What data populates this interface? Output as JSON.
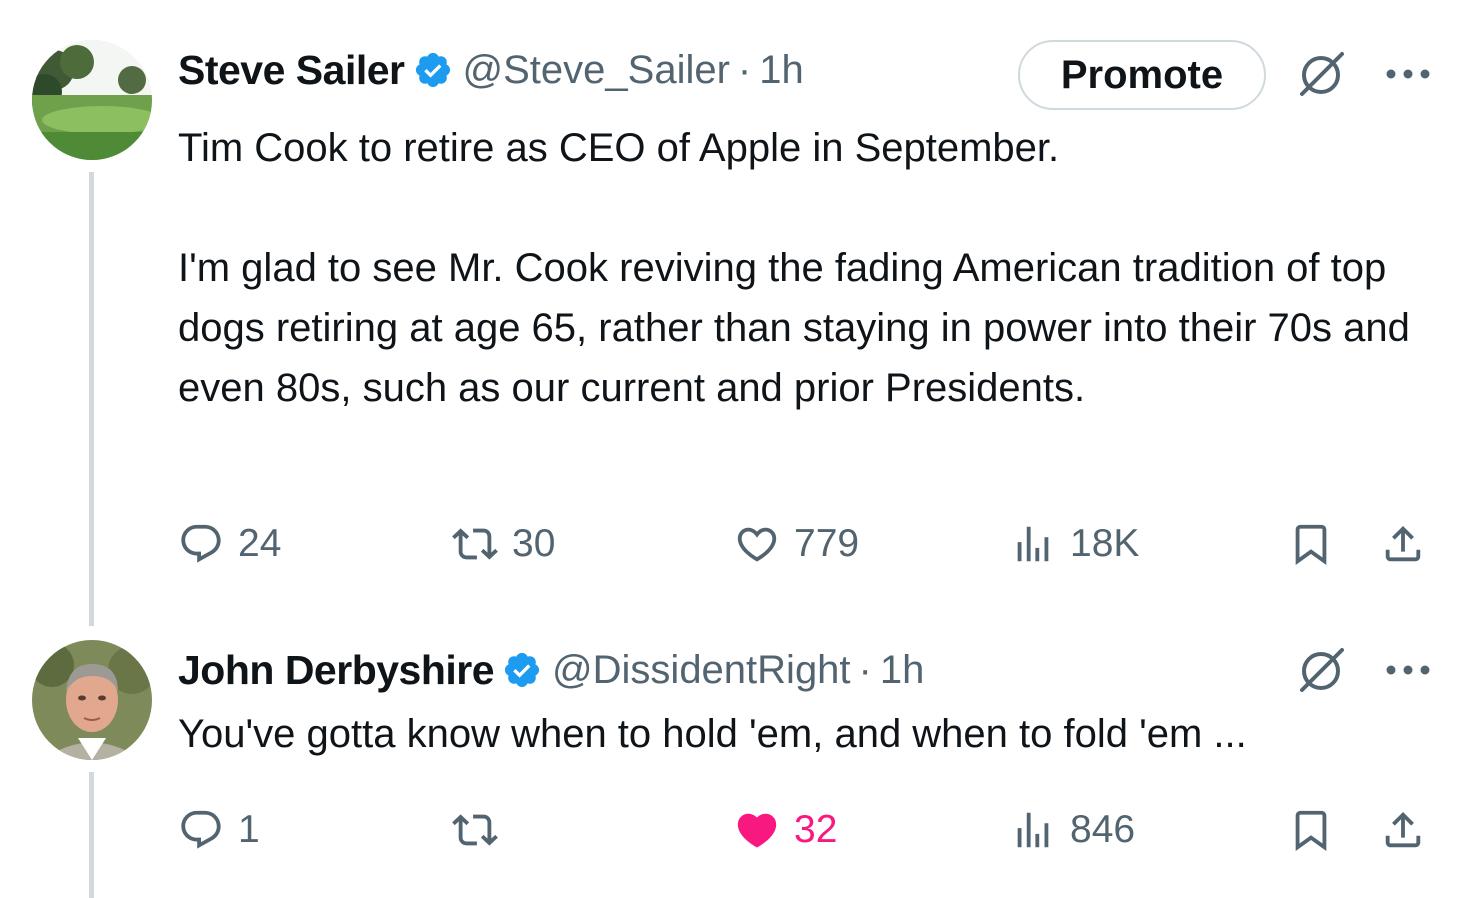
{
  "tweets": [
    {
      "author": "Steve Sailer",
      "handle": "@Steve_Sailer",
      "separator": "·",
      "time": "1h",
      "promote_label": "Promote",
      "text": "Tim Cook to retire as CEO of Apple in September.\n\nI'm glad to see Mr. Cook reviving the fading American tradition of top dogs retiring at age 65, rather than staying in power into their 70s and even 80s, such as our current and prior Presidents.",
      "replies": "24",
      "reposts": "30",
      "likes": "779",
      "views": "18K",
      "liked": false
    },
    {
      "author": "John Derbyshire",
      "handle": "@DissidentRight",
      "separator": "·",
      "time": "1h",
      "text": "You've gotta know when to hold 'em, and when to fold 'em ...",
      "replies": "1",
      "reposts": "",
      "likes": "32",
      "views": "846",
      "liked": true
    }
  ],
  "colors": {
    "text": "#0f1419",
    "secondary": "#536471",
    "verified": "#1d9bf0",
    "like": "#f91880",
    "border": "#cfd9de"
  },
  "icons": [
    "verified-badge-icon",
    "grok-icon",
    "more-icon",
    "reply-icon",
    "repost-icon",
    "like-icon",
    "views-icon",
    "bookmark-icon",
    "share-icon"
  ]
}
